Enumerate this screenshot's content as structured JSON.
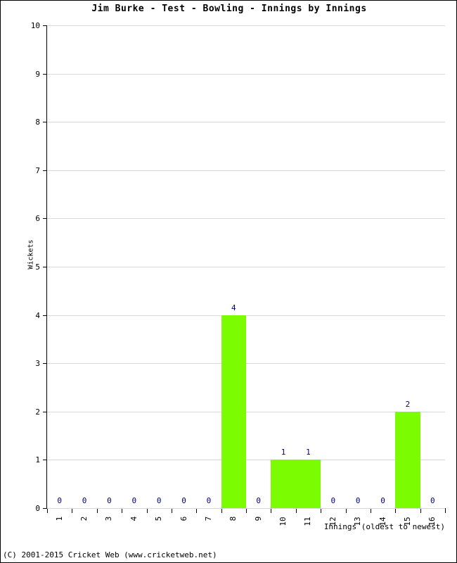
{
  "chart_data": {
    "type": "bar",
    "title": "Jim Burke - Test - Bowling - Innings by Innings",
    "xlabel": "Innings (oldest to newest)",
    "ylabel": "Wickets",
    "categories": [
      "1",
      "2",
      "3",
      "4",
      "5",
      "6",
      "7",
      "8",
      "9",
      "10",
      "11",
      "12",
      "13",
      "14",
      "15",
      "16"
    ],
    "values": [
      0,
      0,
      0,
      0,
      0,
      0,
      0,
      4,
      0,
      1,
      1,
      0,
      0,
      0,
      2,
      0
    ],
    "data_labels": [
      "0",
      "0",
      "0",
      "0",
      "0",
      "0",
      "0",
      "4",
      "0",
      "1",
      "1",
      "0",
      "0",
      "0",
      "2",
      "0"
    ],
    "ylim": [
      0,
      10
    ],
    "y_ticks": [
      "0",
      "1",
      "2",
      "3",
      "4",
      "5",
      "6",
      "7",
      "8",
      "9",
      "10"
    ],
    "grid": true,
    "legend": false,
    "bar_color": "#7CFC00",
    "label_color": "#000080",
    "axis_color": "#000000",
    "grid_color": "#D9D9D9",
    "background": "#FFFFFF"
  },
  "footer": {
    "copyright": "(C) 2001-2015 Cricket Web (www.cricketweb.net)"
  }
}
